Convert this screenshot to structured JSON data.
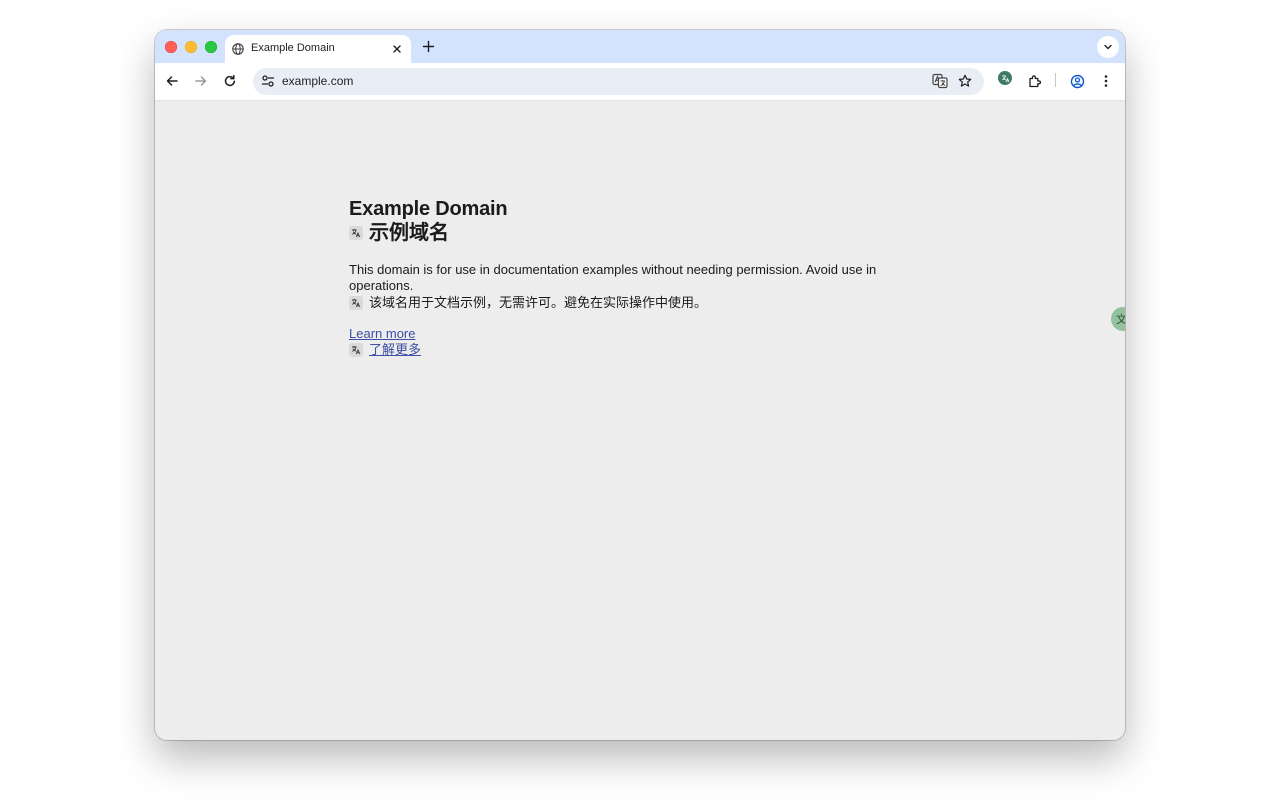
{
  "browser": {
    "tab": {
      "title": "Example Domain"
    },
    "address_bar": {
      "url": "example.com"
    }
  },
  "page": {
    "heading": "Example Domain",
    "heading_translation": "示例域名",
    "paragraph": "This domain is for use in documentation examples without needing permission. Avoid use in operations.",
    "paragraph_translation": "该域名用于文档示例，无需许可。避免在实际操作中使用。",
    "link": "Learn more",
    "link_translation": "了解更多"
  },
  "side_button": {
    "label": "文"
  },
  "icons": [
    "globe-icon",
    "close-icon",
    "plus-icon",
    "chevron-down-icon",
    "back-icon",
    "forward-icon",
    "reload-icon",
    "tune-icon",
    "translate-icon",
    "star-icon",
    "extensions-icon",
    "profile-icon",
    "menu-icon"
  ],
  "colors": {
    "tabstrip": "#d3e3fd",
    "page_background": "#ededed",
    "link": "#3c4fa3",
    "extension": "#3f7a66"
  }
}
